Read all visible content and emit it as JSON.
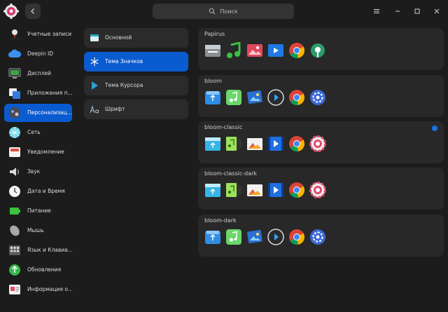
{
  "search": {
    "placeholder": "Поиск"
  },
  "sidebar": {
    "items": [
      {
        "label": "Учетные записи",
        "icon": "accounts-icon"
      },
      {
        "label": "Deepin ID",
        "icon": "cloud-icon"
      },
      {
        "label": "Дисплей",
        "icon": "display-icon"
      },
      {
        "label": "Приложения п...",
        "icon": "default-apps-icon"
      },
      {
        "label": "Персонализац...",
        "icon": "personalization-icon",
        "active": true
      },
      {
        "label": "Сеть",
        "icon": "network-icon"
      },
      {
        "label": "Уведомление",
        "icon": "notification-icon"
      },
      {
        "label": "Звук",
        "icon": "sound-icon"
      },
      {
        "label": "Дата и Время",
        "icon": "clock-icon"
      },
      {
        "label": "Питание",
        "icon": "battery-icon"
      },
      {
        "label": "Мышь",
        "icon": "mouse-icon"
      },
      {
        "label": "Язык и  Клавиа...",
        "icon": "keyboard-icon"
      },
      {
        "label": "Обновления",
        "icon": "update-icon"
      },
      {
        "label": "Информация о...",
        "icon": "system-info-icon"
      }
    ]
  },
  "subnav": {
    "items": [
      {
        "label": "Основной",
        "icon": "window-icon"
      },
      {
        "label": "Тема Значков",
        "icon": "snowflake-icon",
        "active": true
      },
      {
        "label": "Тема Курсора",
        "icon": "cursor-icon"
      },
      {
        "label": "Шрифт",
        "icon": "font-icon"
      }
    ]
  },
  "themes": [
    {
      "name": "Papirus",
      "style": "papirus"
    },
    {
      "name": "bloom",
      "style": "bloom"
    },
    {
      "name": "bloom-classic",
      "style": "classic",
      "selected": true
    },
    {
      "name": "bloom-classic-dark",
      "style": "classic"
    },
    {
      "name": "bloom-dark",
      "style": "bloom"
    }
  ],
  "colors": {
    "accent": "#0a5bd0",
    "selection_dot": "#1a73e8"
  }
}
